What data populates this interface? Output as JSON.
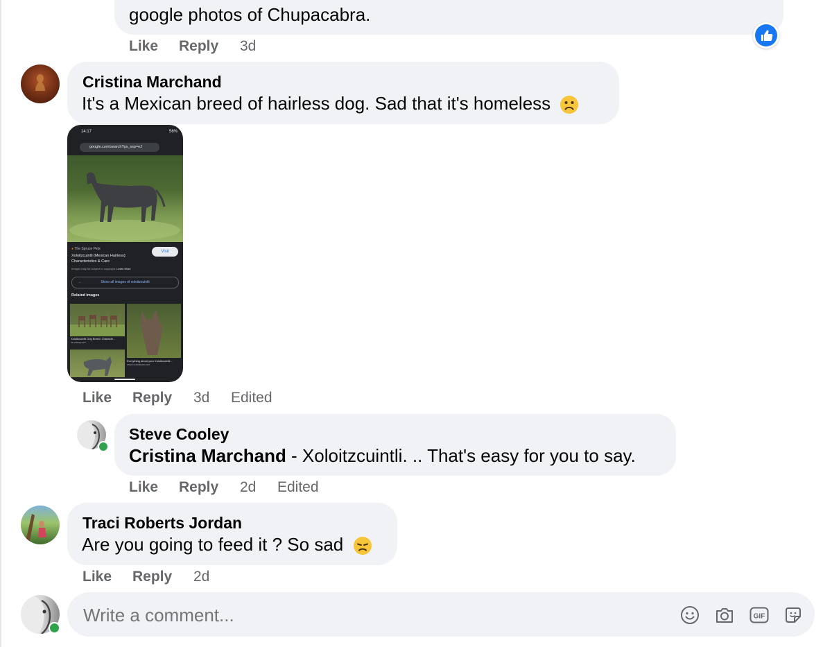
{
  "top_comment": {
    "text": "google photos of Chupacabra.",
    "actions": {
      "like": "Like",
      "reply": "Reply",
      "time": "3d"
    },
    "reaction_icon": "thumbs-up-icon",
    "reaction_color": "#1877f2"
  },
  "comment_cristina": {
    "author": "Cristina Marchand",
    "text": "It's a Mexican breed of hairless dog. Sad that it's homeless",
    "emoji": "frowning-face-icon",
    "actions": {
      "like": "Like",
      "reply": "Reply",
      "time": "3d",
      "edited": "Edited"
    },
    "attachment": {
      "status_time": "14:17",
      "battery": "56%",
      "url": "google.com/search?gs_ssp=eJ",
      "source": "The Spruce Pets",
      "title_line1": "Xoloitzcuintli (Mexican Hairless):",
      "title_line2": "Characteristics & Care",
      "copyright_note": "Images may be subject to copyright.",
      "learn_more": "Learn More",
      "visit_label": "Visit",
      "show_all": "Show all images of xoloitzcuintli",
      "related_heading": "Related images",
      "related_caption_1": "Xoloitzcuintli Dog Breed: Characte...",
      "related_source_1": "be.chewy.com",
      "related_caption_2": "Everything about your Xoloitzcuintli...",
      "related_source_2": "www.lovetoknow.com"
    }
  },
  "reply_steve": {
    "author": "Steve Cooley",
    "mention": "Cristina Marchand",
    "text": " - Xoloitzcuintli. .. That's easy for you to say.",
    "actions": {
      "like": "Like",
      "reply": "Reply",
      "time": "2d",
      "edited": "Edited"
    }
  },
  "comment_traci": {
    "author": "Traci Roberts Jordan",
    "text": "Are you going to feed it ? So sad",
    "emoji": "disappointed-face-icon",
    "actions": {
      "like": "Like",
      "reply": "Reply",
      "time": "2d"
    }
  },
  "composer": {
    "placeholder": "Write a comment...",
    "icons": [
      "emoji-icon",
      "camera-icon",
      "gif-icon",
      "sticker-icon"
    ]
  },
  "colors": {
    "bubble": "#f0f2f5",
    "secondary_text": "#65676b",
    "online": "#31a24c",
    "like_blue": "#1877f2"
  }
}
